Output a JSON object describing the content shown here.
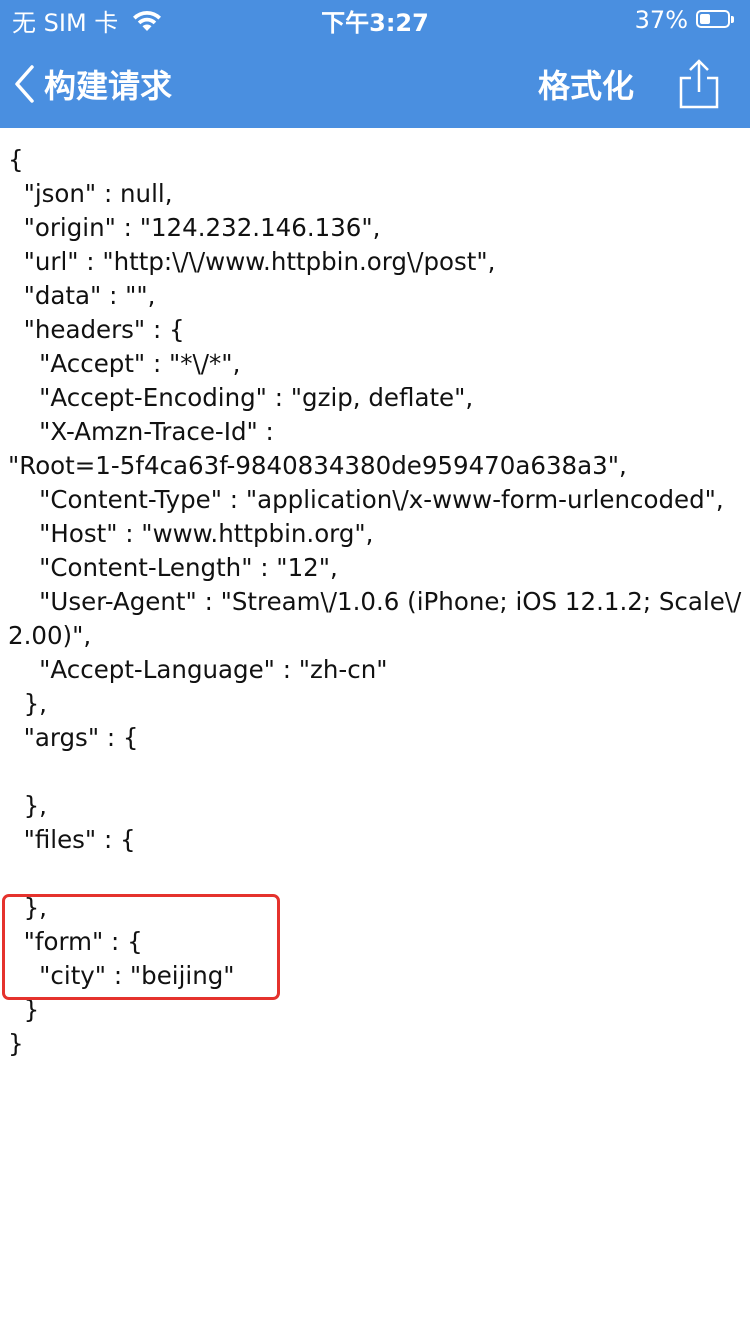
{
  "status_bar": {
    "carrier": "无 SIM 卡",
    "time": "下午3:27",
    "battery_percent": "37%",
    "battery_level": 0.37
  },
  "nav": {
    "back_label": "构建请求",
    "format_label": "格式化",
    "share_icon": "share-icon"
  },
  "json_lines": [
    "{",
    "  \"json\" : null,",
    "  \"origin\" : \"124.232.146.136\",",
    "  \"url\" : \"http:\\/\\/www.httpbin.org\\/post\",",
    "  \"data\" : \"\",",
    "  \"headers\" : {",
    "    \"Accept\" : \"*\\/*\",",
    "    \"Accept-Encoding\" : \"gzip, deflate\",",
    "    \"X-Amzn-Trace-Id\" :",
    "\"Root=1-5f4ca63f-9840834380de959470a638a3\",",
    "    \"Content-Type\" : \"application\\/x-www-form-urlencoded\",",
    "    \"Host\" : \"www.httpbin.org\",",
    "    \"Content-Length\" : \"12\",",
    "    \"User-Agent\" : \"Stream\\/1.0.6 (iPhone; iOS 12.1.2; Scale\\/",
    "2.00)\",",
    "    \"Accept-Language\" : \"zh-cn\"",
    "  },",
    "  \"args\" : {",
    "",
    "  },",
    "  \"files\" : {",
    "",
    "  },",
    "  \"form\" : {",
    "    \"city\" : \"beijing\"",
    "  }",
    "}"
  ],
  "colors": {
    "bar": "#4A8FE0",
    "highlight": "#E5322D"
  }
}
